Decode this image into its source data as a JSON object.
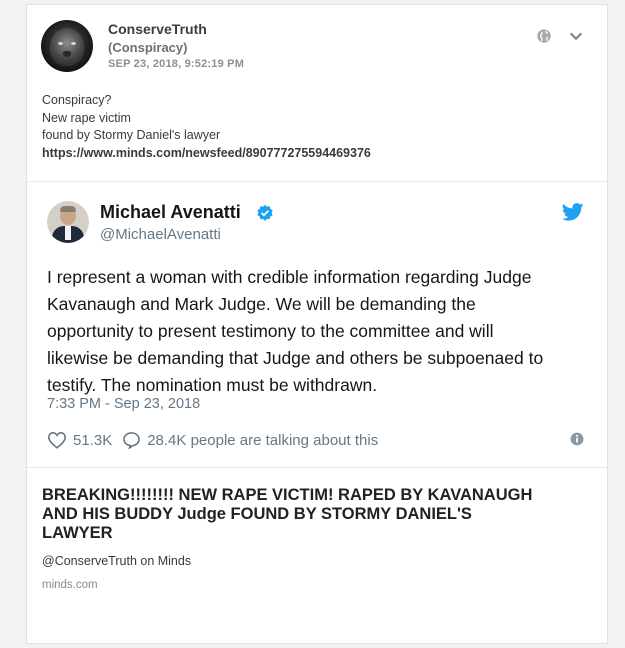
{
  "post": {
    "username": "ConserveTruth",
    "subname": "(Conspiracy)",
    "timestamp": "SEP 23, 2018, 9:52:19 PM",
    "avatar_icon": "lion-avatar",
    "text_lines": [
      "Conspiracy?",
      "New rape victim",
      "found by Stormy Daniel's lawyer"
    ],
    "link": "https://www.minds.com/newsfeed/890777275594469376"
  },
  "tweet": {
    "name": "Michael Avenatti",
    "handle": "@MichaelAvenatti",
    "text_lines": [
      "I represent a woman with credible information regarding Judge",
      "Kavanaugh and Mark Judge. We will be demanding the",
      "opportunity to present testimony to the committee and will",
      "likewise be demanding that Judge and others be subpoenaed to",
      "testify. The nomination must be withdrawn."
    ],
    "time": "7:33 PM - Sep 23, 2018",
    "likes": "51.3K",
    "talking": "28.4K people are talking about this",
    "brand_color": "#1da1f2"
  },
  "preview": {
    "title_lines": [
      "BREAKING!!!!!!!! NEW RAPE VICTIM! RAPED BY KAVANAUGH",
      "AND HIS BUDDY Judge FOUND BY STORMY DANIEL'S",
      "LAWYER"
    ],
    "byline": "@ConserveTruth on Minds",
    "domain": "minds.com"
  }
}
